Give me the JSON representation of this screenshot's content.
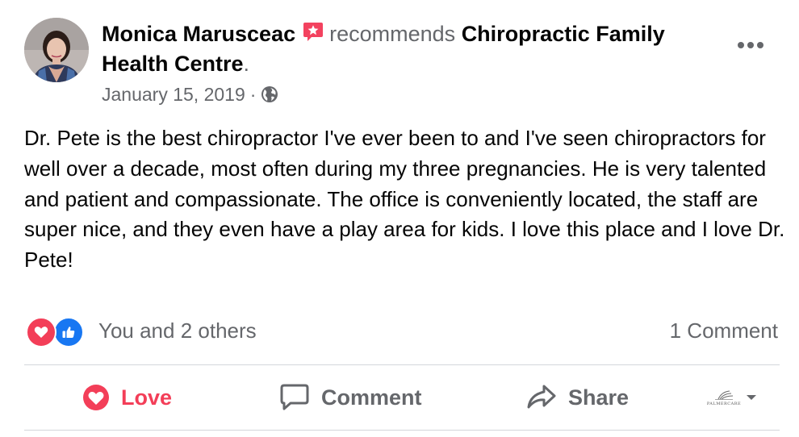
{
  "author": {
    "name": "Monica Marusceac",
    "avatar_icon": "avatar-photo"
  },
  "recommendation": {
    "verb": "recommends",
    "page_name": "Chiropractic Family Health Centre",
    "trailing": ".",
    "icon": "recommend-star-icon",
    "icon_color": "#f3425f"
  },
  "meta": {
    "date": "January 15, 2019",
    "separator": "·",
    "audience_icon": "globe-icon"
  },
  "body": {
    "text": "Dr. Pete is the best chiropractor I've ever been to and I've seen chiropractors for well over a decade, most often during my three pregnancies. He is very talented and patient and compassionate. The office is  conveniently located, the staff are super nice, and they even have a play area for kids. I love this place and I love Dr. Pete!"
  },
  "reactions": {
    "summary": "You and 2 others",
    "types": [
      "love",
      "like"
    ],
    "comments": "1 Comment"
  },
  "actions": {
    "love": "Love",
    "comment": "Comment",
    "share": "Share"
  },
  "page_selector": {
    "logo_text": "PALMERCARE"
  },
  "colors": {
    "love": "#f33e58",
    "like": "#1877f2",
    "secondary_text": "#65676b",
    "divider": "#d3d6db"
  }
}
